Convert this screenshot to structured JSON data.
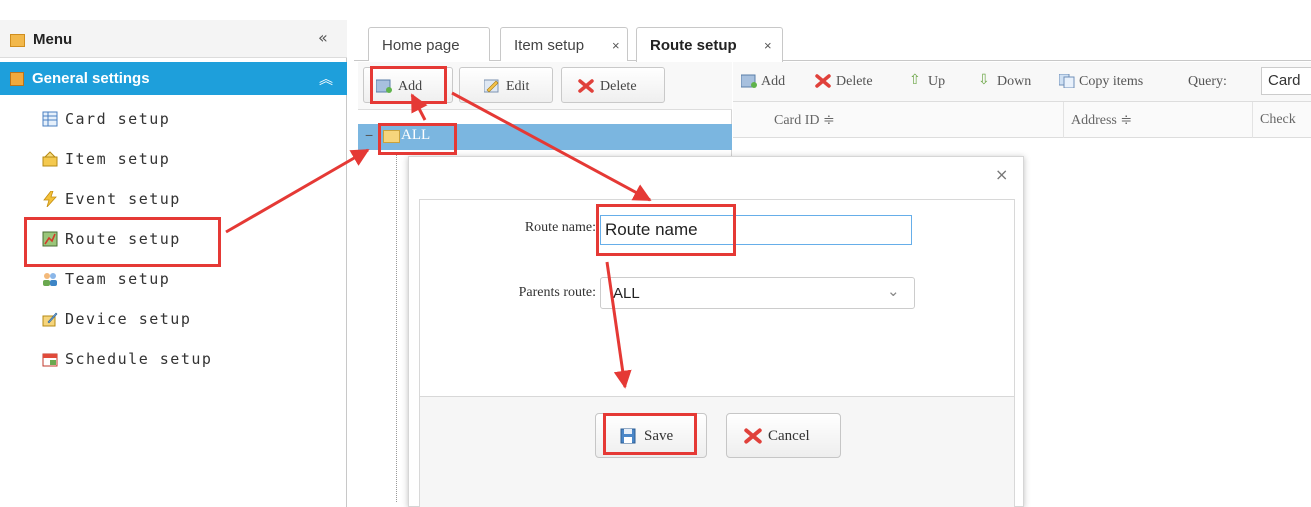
{
  "menu": {
    "title": "Menu",
    "collapse_icon": "double-chevron-left",
    "group": {
      "title": "General settings",
      "toggle_icon": "double-chevron-up"
    },
    "items": [
      {
        "label": "Card setup",
        "icon": "card-icon"
      },
      {
        "label": "Item setup",
        "icon": "item-icon"
      },
      {
        "label": "Event setup",
        "icon": "lightning-icon"
      },
      {
        "label": "Route setup",
        "icon": "route-map-icon"
      },
      {
        "label": "Team setup",
        "icon": "team-icon"
      },
      {
        "label": "Device setup",
        "icon": "device-icon"
      },
      {
        "label": "Schedule setup",
        "icon": "calendar-icon"
      }
    ]
  },
  "tabs": [
    {
      "label": "Home page",
      "closable": false
    },
    {
      "label": "Item setup",
      "closable": true
    },
    {
      "label": "Route setup",
      "closable": true,
      "active": true
    }
  ],
  "tab_close_glyph": "×",
  "tree_toolbar": {
    "add": "Add",
    "edit": "Edit",
    "delete": "Delete"
  },
  "tree": {
    "toggle": "−",
    "root": "ALL"
  },
  "grid_toolbar": {
    "add": "Add",
    "delete": "Delete",
    "up": "Up",
    "down": "Down",
    "copy": "Copy items",
    "query_label": "Query:",
    "query_value": "Card"
  },
  "grid_columns": [
    "Card ID ≑",
    "Address ≑",
    "Check"
  ],
  "dialog": {
    "close_glyph": "×",
    "route_name_label": "Route name:",
    "route_name_value": "Route name",
    "parent_label": "Parents route:",
    "parent_value": "ALL",
    "save": "Save",
    "cancel": "Cancel"
  },
  "colors": {
    "menu_group_bg": "#1e9fdb",
    "tree_selected_bg": "#7bb6e0",
    "highlight": "#e53935"
  }
}
